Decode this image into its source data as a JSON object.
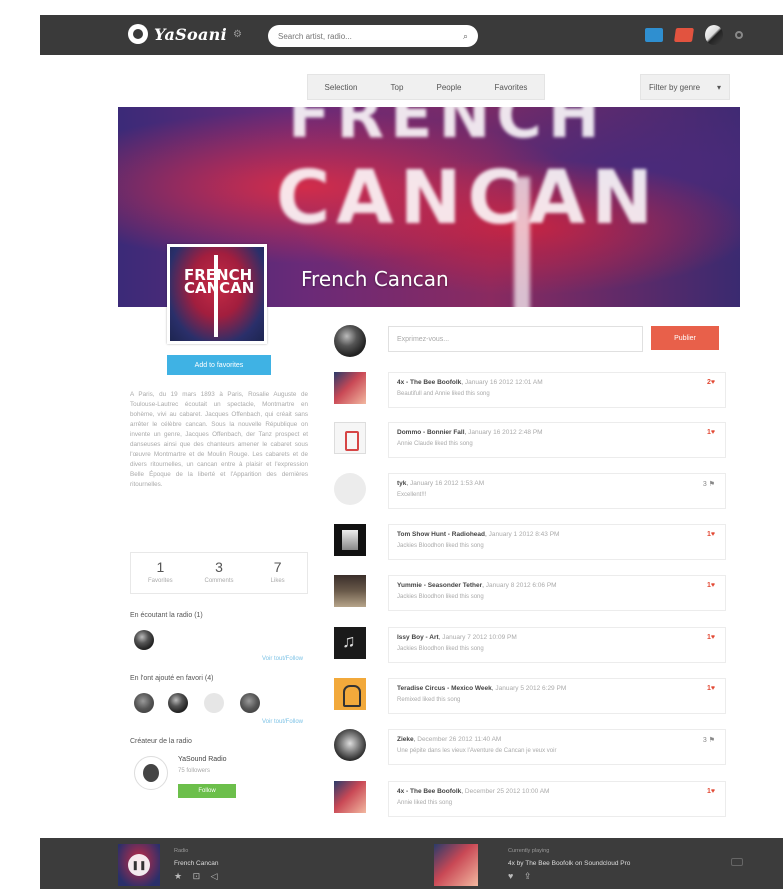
{
  "header": {
    "logo": "YaSoani",
    "search_placeholder": "Search artist, radio..."
  },
  "subnav": {
    "tabs": [
      "Selection",
      "Top",
      "People",
      "Favorites"
    ],
    "filter_label": "Filter by genre"
  },
  "radio": {
    "banner_big_line1": "FRENCH",
    "banner_big_line2": "CANCAN",
    "title": "French Cancan",
    "cover_text": "FRENCH CANCAN",
    "add_button": "Add to favorites",
    "description": "A Paris, du 19 mars 1893 à Paris, Rosalie Auguste de Toulouse-Lautrec écoutait un spectacle, Montmartre en bohème, vivi au cabaret. Jacques Offenbach, qui créait sans arrêter le célèbre cancan. Sous la nouvelle République on invente un genre, Jacques Offenbach, der Tanz prospect et danseuses ainsi que des chanteurs amener le cabaret sous l'œuvre Montmartre et de Moulin Rouge. Les cabarets et de divers ritournelles, un cancan entre à plaisir et l'expression Belle Époque de la liberté et l'Apparition des dernières ritournelles.",
    "stats": [
      {
        "num": "1",
        "label": "Favorites"
      },
      {
        "num": "3",
        "label": "Comments"
      },
      {
        "num": "7",
        "label": "Likes"
      }
    ],
    "listeners_title": "En écoutant la radio (1)",
    "see_all": "Voir tout/Follow",
    "added_title": "En l'ont ajouté en favori (4)",
    "creator_title": "Créateur de la radio",
    "creator_name": "YaSound Radio",
    "creator_sub": "75 followers",
    "follow_button": "Follow"
  },
  "post": {
    "placeholder": "Exprimez-vous...",
    "button": "Publier"
  },
  "feed": [
    {
      "title": "4x - The Bee Boofolk",
      "date": "January 16 2012 12:01 AM",
      "sub": "Beautifull and Annie liked this song",
      "count": "2♥"
    },
    {
      "title": "Dommo - Bonnier Fall",
      "date": "January 16 2012 2:48 PM",
      "sub": "Annie Claude liked this song",
      "count": "1♥"
    },
    {
      "title": "tyk",
      "date": "January 16 2012 1:53 AM",
      "sub": "Excellent!!!",
      "count": "3 ⚑"
    },
    {
      "title": "Tom Show Hunt - Radiohead",
      "date": "January 1 2012 8:43 PM",
      "sub": "Jackies Bloodhon liked this song",
      "count": "1♥"
    },
    {
      "title": "Yummie - Seasonder Tether",
      "date": "January 8 2012 6:06 PM",
      "sub": "Jackies Bloodhon liked this song",
      "count": "1♥"
    },
    {
      "title": "Issy Boy - Art",
      "date": "January 7 2012 10:09 PM",
      "sub": "Jackies Bloodhon liked this song",
      "count": "1♥"
    },
    {
      "title": "Teradise Circus - Mexico Week",
      "date": "January 5 2012 6:29 PM",
      "sub": "Remixed liked this song",
      "count": "1♥"
    },
    {
      "title": "Zieke",
      "date": "December 26 2012 11:40 AM",
      "sub": "Une pépite dans les vieux l'Aventure de Cancan je veux voir",
      "count": "3 ⚑"
    },
    {
      "title": "4x - The Bee Boofolk",
      "date": "December 25 2012 10:00 AM",
      "sub": "Annie liked this song",
      "count": "1♥"
    }
  ],
  "player": {
    "left_label": "Radio",
    "left_title": "French Cancan",
    "right_label": "Currently playing",
    "right_title": "4x by The Bee Boofolk on Soundcloud Pro",
    "controls_left": "★ ⊡ ◁",
    "controls_right": "♥ ⇪"
  }
}
